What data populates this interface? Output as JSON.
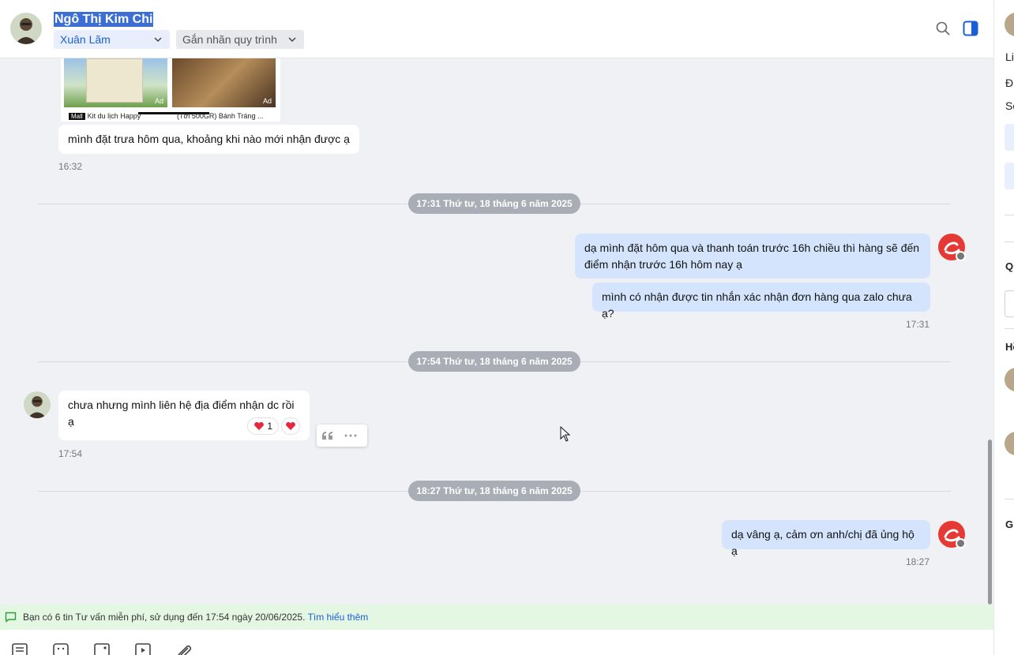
{
  "header": {
    "contact_name": "Ngô Thị Kim Chi",
    "assignee": "Xuân Lãm",
    "label_dropdown": "Gắn nhãn quy trình"
  },
  "link_preview": {
    "caption_1": "Kit du lịch Happy",
    "caption_1_badge": "Mall",
    "caption_2": "(Tới 500GR) Bánh Tráng ...",
    "ad": "Ad"
  },
  "messages": [
    {
      "text": "mình đặt trưa hôm qua, khoảng khi nào mới nhận được ạ",
      "time": "16:32"
    },
    {
      "text": "dạ mình đặt hôm qua và thanh toán trước 16h chiều thì hàng sẽ đến điểm nhận trước 16h hôm nay ạ"
    },
    {
      "text": "mình có nhận được tin nhắn xác nhận đơn hàng qua zalo chưa ạ?",
      "time": "17:31"
    },
    {
      "text": "chưa nhưng mình liên hệ địa điểm nhận dc rồi ạ",
      "time": "17:54",
      "reaction_count": "1"
    },
    {
      "text": "dạ vâng ạ, cảm ơn anh/chị đã ủng hộ ạ",
      "time": "18:27"
    }
  ],
  "date_separators": [
    "17:31 Thứ tư, 18 tháng 6 năm 2025",
    "17:54 Thứ tư, 18 tháng 6 năm 2025",
    "18:27 Thứ tư, 18 tháng 6 năm 2025"
  ],
  "notice": {
    "text": "Bạn có 6 tin Tư vấn miễn phí, sử dụng đến 17:54 ngày 20/06/2025.",
    "link": "Tìm hiểu thêm"
  },
  "right_panel": {
    "partial_labels": [
      "Li",
      "Đị",
      "Số",
      "Qu",
      "Hồ",
      "Gl"
    ]
  },
  "icons": {
    "brand_color": "#e53935",
    "accent_color": "#1a5fd6",
    "heart_color": "#e5283e"
  }
}
